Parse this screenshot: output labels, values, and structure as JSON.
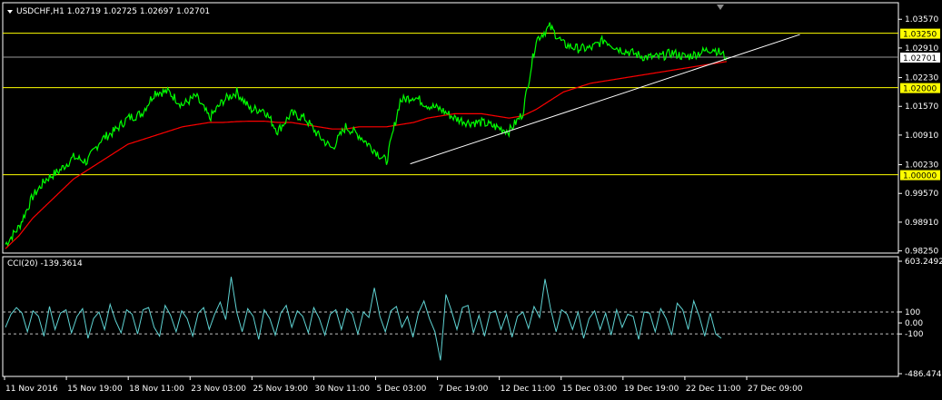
{
  "main_header": {
    "symbol": "USDCHF,H1",
    "ohlc": "1.02719 1.02725 1.02697 1.02701"
  },
  "cci_header": "CCI(20) -139.3614",
  "colors": {
    "background": "#000000",
    "price": "#00ff00",
    "ma": "#ff0000",
    "hline": "#ffff00",
    "trend": "#ffffff",
    "cci": "#5fd3d3",
    "axis": "#ffffff",
    "badge": "#ffff00",
    "current_badge": "#ffffff"
  },
  "chart_data": [
    {
      "type": "line",
      "title": "USDCHF,H1",
      "price_axis_ticks": [
        "1.03570",
        "1.02910",
        "1.02230",
        "1.01570",
        "1.00910",
        "1.00230",
        "0.99570",
        "0.98910",
        "0.98250"
      ],
      "price_ticks_values": [
        1.0357,
        1.0291,
        1.0223,
        1.0157,
        1.0091,
        1.0023,
        0.9957,
        0.9891,
        0.9825
      ],
      "ylim": [
        0.982,
        1.0395
      ],
      "x_ticks": [
        "11 Nov 2016",
        "15 Nov 19:00",
        "18 Nov 11:00",
        "23 Nov 03:00",
        "25 Nov 19:00",
        "30 Nov 11:00",
        "5 Dec 03:00",
        "7 Dec 19:00",
        "12 Dec 11:00",
        "15 Dec 03:00",
        "19 Dec 19:00",
        "22 Dec 11:00",
        "27 Dec 09:00"
      ],
      "series": [
        {
          "values": [
            0.984,
            0.988,
            0.995,
            0.999,
            1.001,
            1.004,
            1.003,
            1.008,
            1.01,
            1.013,
            1.014,
            1.019,
            1.019,
            1.016,
            1.018,
            1.013,
            1.017,
            1.019,
            1.015,
            1.015,
            1.01,
            1.014,
            1.013,
            1.009,
            1.006,
            1.011,
            1.009,
            1.006,
            1.003,
            1.017,
            1.018,
            1.016,
            1.015,
            1.013,
            1.012,
            1.012,
            1.011,
            1.01,
            1.014,
            1.031,
            1.034,
            1.03,
            1.029,
            1.029,
            1.031,
            1.029,
            1.028,
            1.027,
            1.027,
            1.028,
            1.027,
            1.028,
            1.029,
            1.027
          ]
        },
        {
          "values": [
            0.983,
            0.986,
            0.99,
            0.993,
            0.996,
            0.999,
            1.001,
            1.003,
            1.005,
            1.007,
            1.008,
            1.009,
            1.01,
            1.011,
            1.0115,
            1.012,
            1.012,
            1.0122,
            1.0123,
            1.0123,
            1.012,
            1.012,
            1.0115,
            1.011,
            1.0105,
            1.0105,
            1.011,
            1.011,
            1.011,
            1.0115,
            1.012,
            1.013,
            1.0135,
            1.014,
            1.014,
            1.014,
            1.0135,
            1.013,
            1.0135,
            1.015,
            1.017,
            1.019,
            1.02,
            1.021,
            1.0215,
            1.022,
            1.0225,
            1.023,
            1.0235,
            1.024,
            1.0245,
            1.025,
            1.0255,
            1.026
          ]
        }
      ],
      "hlines": [
        {
          "label": "1.03250",
          "value": 1.0325
        },
        {
          "label": "1.02000",
          "value": 1.02
        },
        {
          "label": "1.00000",
          "value": 1.0
        }
      ],
      "current_price": {
        "label": "1.02701",
        "value": 1.02701
      },
      "trendline": {
        "from": [
          0.455,
          1.0025
        ],
        "to": [
          0.89,
          1.0322
        ]
      }
    },
    {
      "type": "line",
      "title": "CCI(20)",
      "y_ticks": [
        "603.2492",
        "100",
        "0.00",
        "-100",
        "-486.4747"
      ],
      "y_ticks_values": [
        603.2492,
        100,
        0,
        -100,
        -486.4747
      ],
      "ylim": [
        -486.4747,
        603.2492
      ],
      "levels": [
        100,
        -100
      ],
      "series": [
        {
          "values": [
            -40,
            80,
            140,
            90,
            -80,
            110,
            60,
            -120,
            150,
            -60,
            90,
            120,
            -90,
            60,
            130,
            -140,
            40,
            100,
            -60,
            170,
            20,
            -90,
            120,
            80,
            -100,
            120,
            140,
            -40,
            -120,
            160,
            70,
            -80,
            110,
            40,
            -120,
            90,
            140,
            -60,
            80,
            190,
            30,
            420,
            100,
            -80,
            130,
            60,
            -150,
            120,
            40,
            -110,
            90,
            160,
            -40,
            110,
            60,
            -90,
            140,
            40,
            -110,
            80,
            120,
            -60,
            130,
            80,
            -100,
            100,
            50,
            320,
            60,
            -80,
            110,
            150,
            -40,
            60,
            -130,
            90,
            200,
            40,
            -80,
            -340,
            260,
            110,
            -60,
            140,
            160,
            -90,
            70,
            -120,
            90,
            110,
            -60,
            80,
            -130,
            60,
            100,
            -50,
            150,
            50,
            400,
            130,
            -80,
            120,
            80,
            -60,
            100,
            -140,
            40,
            110,
            -60,
            90,
            -110,
            120,
            -40,
            80,
            60,
            -150,
            100,
            90,
            -80,
            130,
            40,
            -110,
            180,
            120,
            -60,
            200,
            60,
            -120,
            90,
            -100,
            -139
          ]
        }
      ]
    }
  ]
}
